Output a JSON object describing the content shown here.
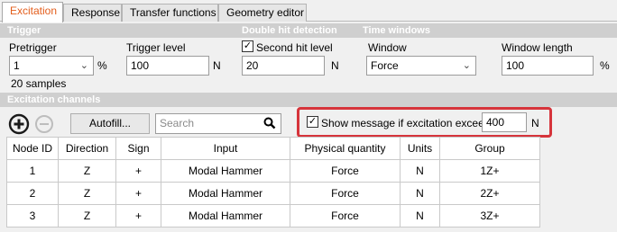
{
  "tabs": [
    "Excitation",
    "Response",
    "Transfer functions",
    "Geometry editor"
  ],
  "sections": {
    "trigger": "Trigger",
    "double_hit": "Double hit detection",
    "time_windows": "Time windows",
    "channels": "Excitation channels"
  },
  "trigger": {
    "pretrigger_label": "Pretrigger",
    "pretrigger_value": "1",
    "pretrigger_unit": "%",
    "pretrigger_samples": "20 samples",
    "trigger_level_label": "Trigger level",
    "trigger_level_value": "100",
    "trigger_level_unit": "N"
  },
  "double_hit": {
    "checkbox_label": "Second hit level",
    "checked": true,
    "value": "20",
    "unit": "N"
  },
  "time_windows": {
    "window_label": "Window",
    "window_value": "Force",
    "length_label": "Window length",
    "length_value": "100",
    "length_unit": "%"
  },
  "channels_toolbar": {
    "autofill_label": "Autofill...",
    "search_placeholder": "Search",
    "show_message_label": "Show message if excitation exceeds",
    "show_message_checked": true,
    "threshold_value": "400",
    "threshold_unit": "N"
  },
  "table": {
    "headers": [
      "Node ID",
      "Direction",
      "Sign",
      "Input",
      "Physical quantity",
      "Units",
      "Group"
    ],
    "rows": [
      [
        "1",
        "Z",
        "+",
        "Modal Hammer",
        "Force",
        "N",
        "1Z+"
      ],
      [
        "2",
        "Z",
        "+",
        "Modal Hammer",
        "Force",
        "N",
        "2Z+"
      ],
      [
        "3",
        "Z",
        "+",
        "Modal Hammer",
        "Force",
        "N",
        "3Z+"
      ]
    ]
  },
  "icons": {
    "add": "plus-circle-icon",
    "remove": "minus-circle-icon",
    "search": "search-icon",
    "dropdown": "chevron-down-icon",
    "check": "checkmark-icon"
  },
  "colors": {
    "active_tab": "#e35d1b",
    "highlight": "#d6343b",
    "section_bar": "#cfcfcf"
  }
}
